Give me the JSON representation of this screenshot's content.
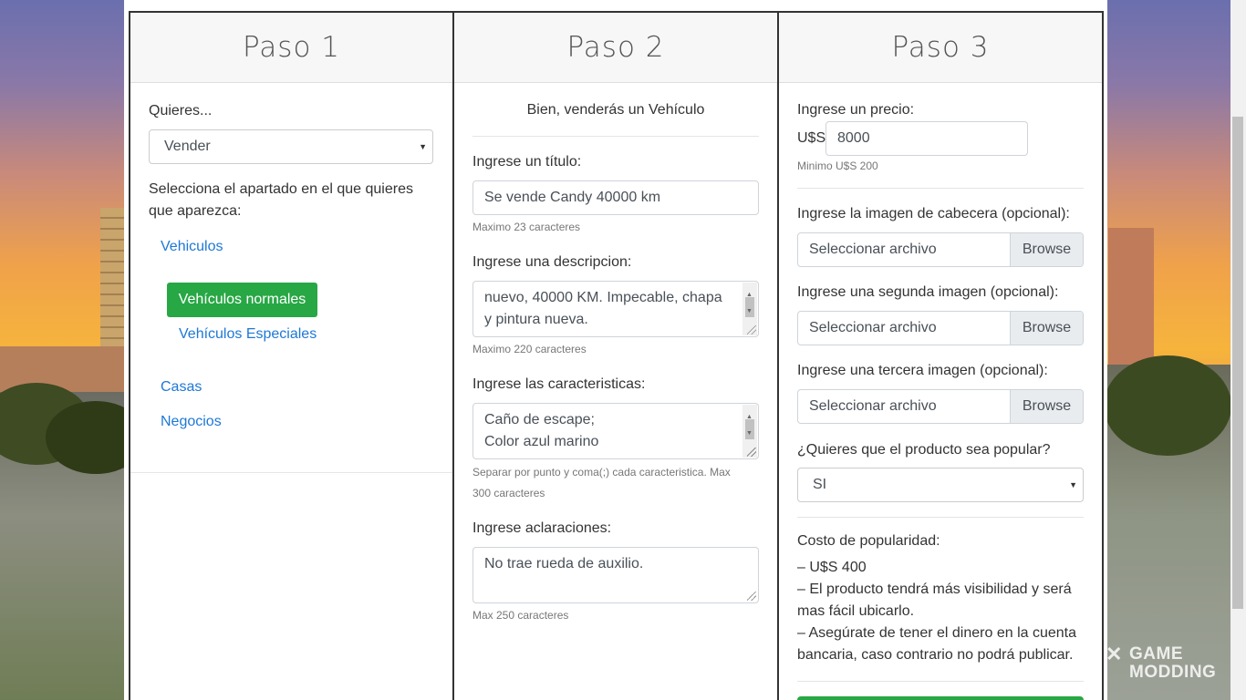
{
  "watermark": {
    "line1": "GAME",
    "line2": "MODDING"
  },
  "step1": {
    "title": "Paso 1",
    "question": "Quieres...",
    "action_select": "Vender",
    "section_prompt_1": "Selecciona el apartado en el que quieres",
    "section_prompt_2": "que aparezca:",
    "categories": {
      "vehiculos": "Vehiculos",
      "normales": "Vehículos normales",
      "especiales": "Vehículos Especiales",
      "casas": "Casas",
      "negocios": "Negocios"
    }
  },
  "step2": {
    "title": "Paso 2",
    "intro": "Bien, venderás un Vehículo",
    "title_label": "Ingrese un título:",
    "title_value": "Se vende Candy 40000 km",
    "title_help": "Maximo 23 caracteres",
    "desc_label": "Ingrese una descripcion:",
    "desc_line1": "nuevo, 40000 KM. Impecable, chapa",
    "desc_line2": "y pintura nueva.",
    "desc_help": "Maximo 220 caracteres",
    "features_label": "Ingrese las caracteristicas:",
    "features_line1": "Caño de escape;",
    "features_line2": "Color azul marino",
    "features_help_1": "Separar por punto y coma(;) cada caracteristica. Max",
    "features_help_2": "300 caracteres",
    "notes_label": "Ingrese aclaraciones:",
    "notes_value": "No trae rueda de auxilio.",
    "notes_help": "Max 250 caracteres"
  },
  "step3": {
    "title": "Paso 3",
    "price_label": "Ingrese un precio:",
    "currency": "U$S",
    "price_value": "8000",
    "price_help": "Minimo U$S 200",
    "img1_label": "Ingrese la imagen de cabecera (opcional):",
    "img2_label": "Ingrese una segunda imagen (opcional):",
    "img3_label": "Ingrese una tercera imagen (opcional):",
    "file_placeholder": "Seleccionar archivo",
    "browse_label": "Browse",
    "popular_label": "¿Quieres que el producto sea popular?",
    "popular_value": "SI",
    "cost_label": "Costo de popularidad:",
    "cost_line1": "– U$S 400",
    "cost_line2a": "– El producto tendrá más visibilidad y será",
    "cost_line2b": "mas fácil ubicarlo.",
    "cost_line3a": "– Asegúrate de tener el dinero en la cuenta",
    "cost_line3b": "bancaria, caso contrario no podrá publicar."
  }
}
